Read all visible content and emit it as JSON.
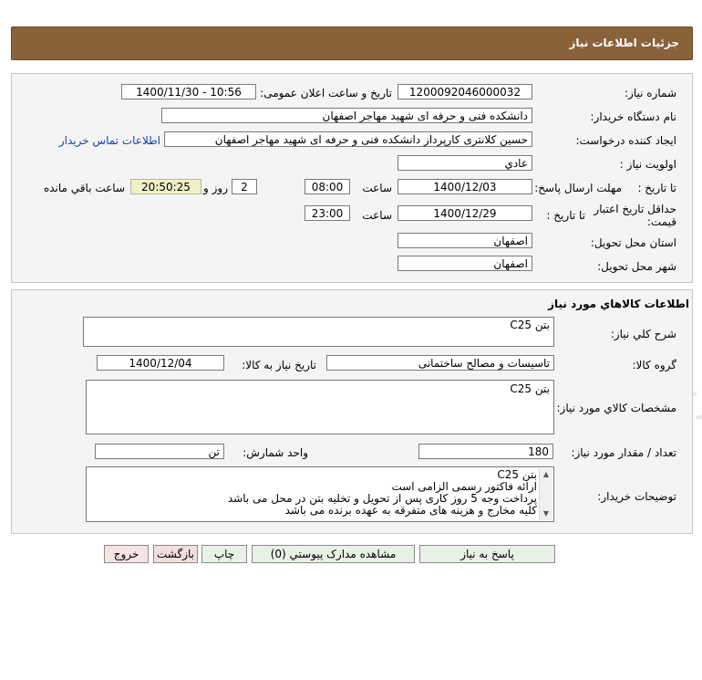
{
  "header": {
    "title": "جزئيات اطلاعات نياز"
  },
  "info": {
    "need_number_label": "شماره نياز:",
    "need_number": "1200092046000032",
    "announce_label": "تاريخ و ساعت اعلان عمومی:",
    "announce_value": "1400/11/30 - 10:56",
    "buyer_org_label": "نام دستگاه خريدار:",
    "buyer_org": "دانشکده فنی و حرفه ای شهید مهاجر اصفهان",
    "requester_label": "ايجاد کننده درخواست:",
    "requester": "حسین کلانتری کارپرداز دانشکده فنی و حرفه ای شهید مهاجر اصفهان",
    "contact_link": "اطلاعات تماس خريدار",
    "priority_label": "اولويت نياز :",
    "priority": "عادي",
    "send_deadline_label": "مهلت ارسال پاسخ:",
    "until_date_label": "تا تاريخ :",
    "send_date": "1400/12/03",
    "time_label": "ساعت",
    "send_time": "08:00",
    "days": "2",
    "days_and_label": "روز و",
    "remaining_time": "20:50:25",
    "remaining_label": "ساعت باقي مانده",
    "price_validity_label_1": "حداقل تاريخ اعتبار",
    "price_validity_label_2": "قيمت:",
    "validity_date": "1400/12/29",
    "validity_time": "23:00",
    "delivery_province_label": "استان محل تحويل:",
    "delivery_province": "اصفهان",
    "delivery_city_label": "شهر محل تحويل:",
    "delivery_city": "اصفهان"
  },
  "goods": {
    "section_title": "اطلاعات کالاهاي مورد نياز",
    "general_desc_label": "شرح کلي نياز:",
    "general_desc": "بتن C25",
    "group_label": "گروه کالا:",
    "group_value": "تاسیسات و مصالح ساختمانی",
    "need_date_label": "تاريخ نياز به کالا:",
    "need_date": "1400/12/04",
    "specs_label": "مشخصات کالاي مورد نياز:",
    "specs_value": "بتن C25",
    "qty_label": "تعداد / مقدار مورد نياز:",
    "qty_value": "180",
    "unit_label": "واحد شمارش:",
    "unit_value": "تن",
    "buyer_notes_label": "توضيحات خريدار:",
    "buyer_notes_lines": [
      "بتن C25",
      "ارائه فاکتور رسمی الزامی است",
      "پرداخت وجه 5 روز کاری پس از تحویل و تخلیه بتن در محل می باشد",
      "کلیه مخارج و هزینه های متفرقه به عهده برنده می باشد"
    ]
  },
  "actions": {
    "reply": "پاسخ به نياز",
    "attachments": "مشاهده مدارک پيوستي (0)",
    "print": "چاپ",
    "back": "بازگشت",
    "exit": "خروج"
  },
  "colors": {
    "header_bg": "#8a6239",
    "panel_bg": "#f4f4f4",
    "timer_bg": "#f0efc7",
    "link": "#1a3fa8"
  }
}
